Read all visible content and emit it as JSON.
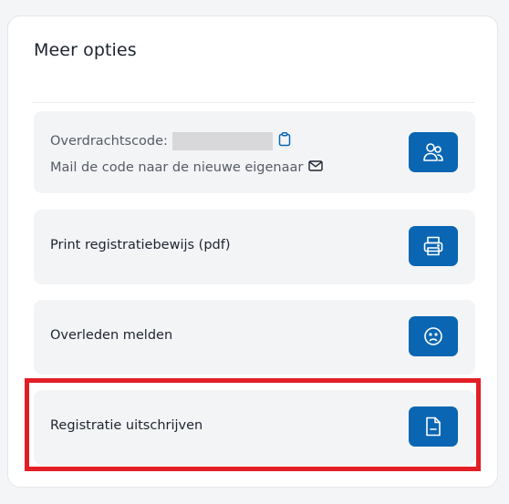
{
  "panel": {
    "title": "Meer opties"
  },
  "rows": {
    "transfer": {
      "code_label": "Overdrachtscode:",
      "mail_label": "Mail de code naar de nieuwe eigenaar"
    },
    "print": {
      "label": "Print registratiebewijs (pdf)"
    },
    "deceased": {
      "label": "Overleden melden"
    },
    "deregister": {
      "label": "Registratie uitschrijven"
    }
  },
  "icons": {
    "transfer": "users-icon",
    "print": "printer-icon",
    "deceased": "sad-face-icon",
    "deregister": "document-minus-icon",
    "copy": "clipboard-icon",
    "mail": "envelope-icon"
  },
  "colors": {
    "accent": "#0a66b3",
    "row_background": "#f3f4f6",
    "highlight": "#e41e26"
  }
}
